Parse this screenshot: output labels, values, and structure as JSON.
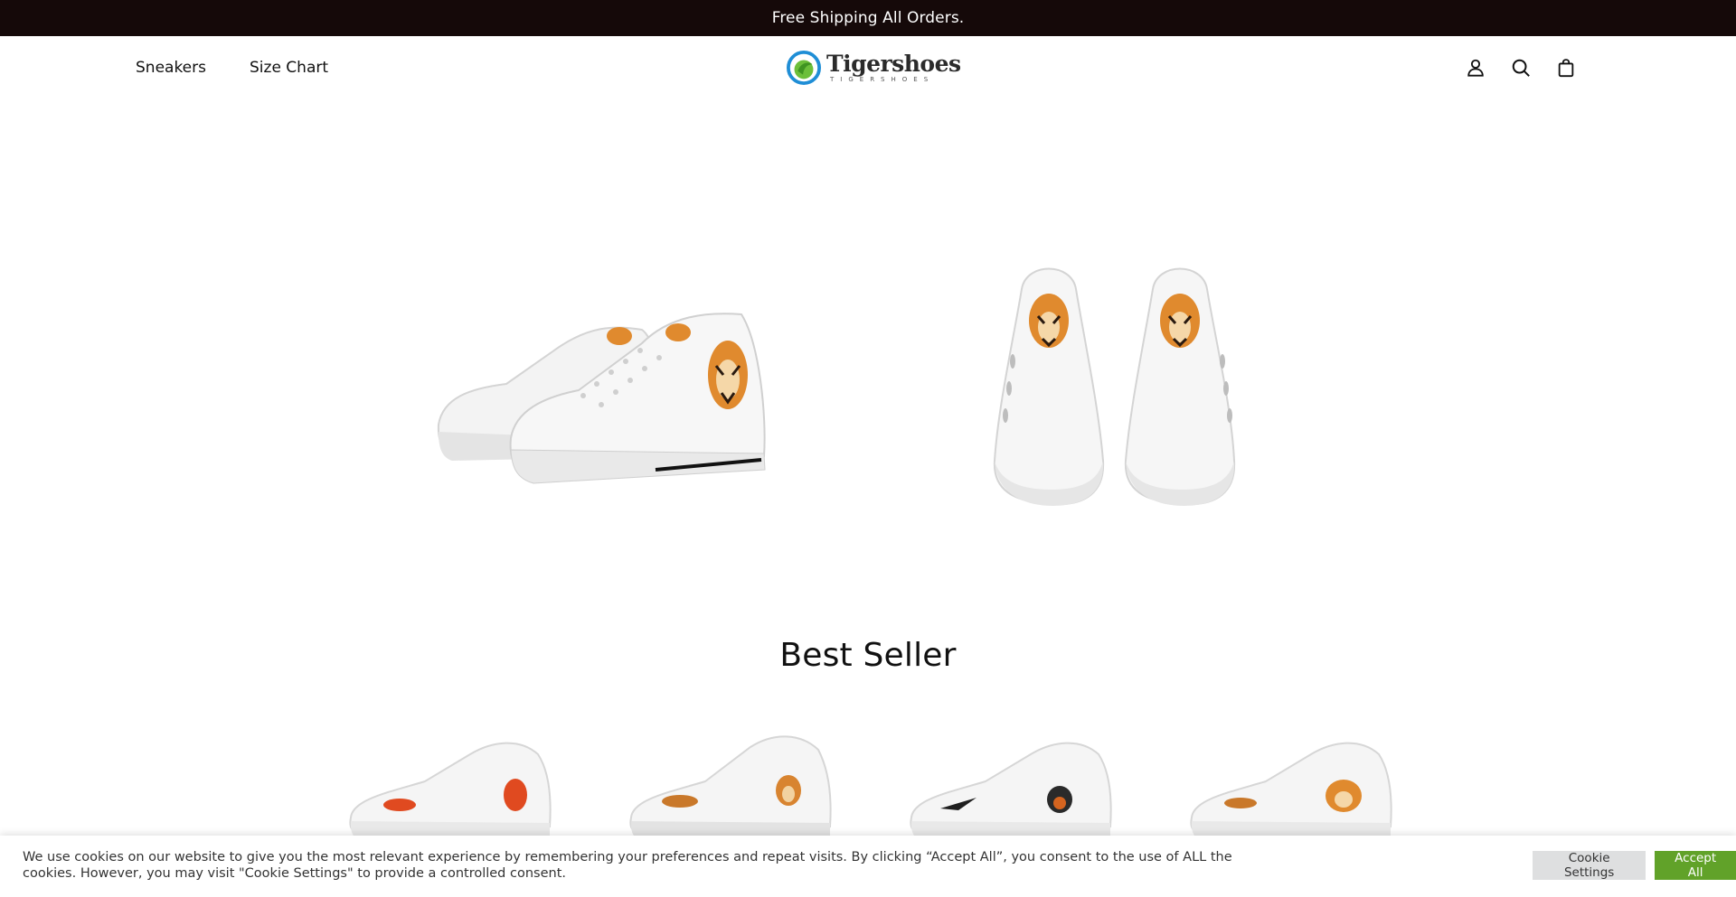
{
  "announcement": {
    "text": "Free Shipping All Orders."
  },
  "header": {
    "nav": [
      {
        "label": "Sneakers"
      },
      {
        "label": "Size Chart"
      }
    ],
    "logo": {
      "name": "Tigershoes",
      "subtitle": "TIGERSHOES"
    },
    "icons": [
      "account-icon",
      "search-icon",
      "cart-icon"
    ]
  },
  "hero": {
    "images": [
      "white high-top sneaker with tiger print, side view",
      "white high-top sneakers with tiger print, back view"
    ]
  },
  "best_seller": {
    "title": "Best Seller",
    "products": [
      {
        "image": "white running sneaker with red tiger"
      },
      {
        "image": "white running sneaker with tiger face"
      },
      {
        "image": "white running sneaker with black tiger"
      },
      {
        "image": "white running sneaker with orange tiger"
      }
    ]
  },
  "cookie_banner": {
    "text": "We use cookies on our website to give you the most relevant experience by remembering your preferences and repeat visits. By clicking “Accept All”, you consent to the use of ALL the cookies. However, you may visit \"Cookie Settings\" to provide a controlled consent.",
    "settings_label": "Cookie Settings",
    "accept_label": "Accept All"
  },
  "colors": {
    "announcement_bg": "#150909",
    "accept_button": "#61a229",
    "settings_button": "#dedfe0"
  }
}
